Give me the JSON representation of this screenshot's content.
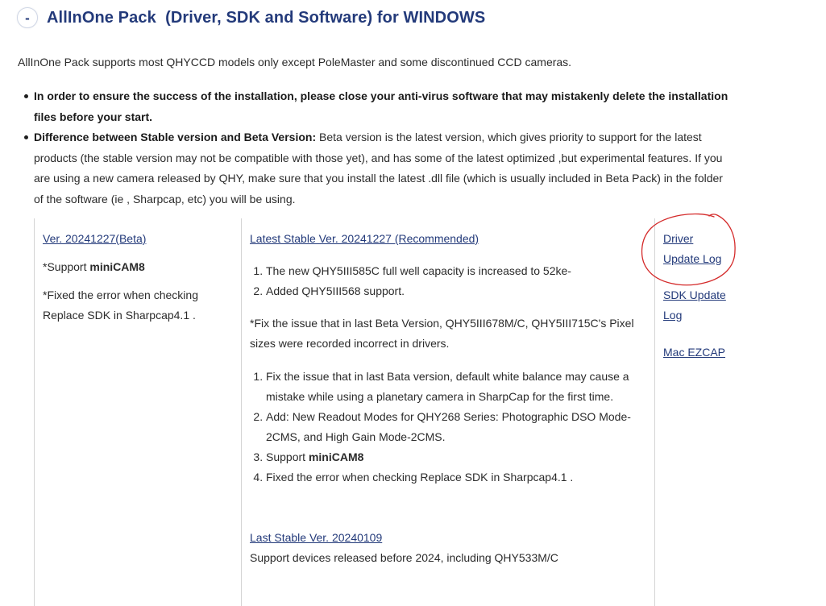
{
  "section": {
    "toggle_symbol": "-",
    "title": "AllInOne Pack  (Driver, SDK and Software) for WINDOWS",
    "intro": "AllInOne Pack supports most QHYCCD models only except PoleMaster and some discontinued CCD cameras."
  },
  "bullets": [
    {
      "bold": "In order to ensure the success of the installation, please close your anti-virus software that may mistakenly delete the installation files before your start.",
      "text": ""
    },
    {
      "bold": "Difference between Stable version and Beta Version:",
      "text": " Beta version is the latest version, which gives priority to support for the latest products (the stable version may not be compatible with those yet), and has some of the latest optimized ,but experimental features. If you are using a new camera released by QHY, make sure that you install the latest .dll file (which is usually included in Beta Pack) in the folder of the software (ie , Sharpcap, etc) you will be using."
    }
  ],
  "beta": {
    "link": "Ver. 20241227(Beta)",
    "support_prefix": "*Support ",
    "support_model": "miniCAM8",
    "fix_note": "*Fixed the error when checking Replace SDK in Sharpcap4.1 ."
  },
  "stable": {
    "link": "Latest Stable Ver. 20241227 (Recommended)",
    "list1": [
      "The new QHY5III585C full well capacity is increased to 52ke-",
      "Added QHY5III568 support."
    ],
    "fix_note": "*Fix the issue that in last Beta Version, QHY5III678M/C, QHY5III715C's Pixel sizes were recorded incorrect in drivers.",
    "list2_item1": "Fix the issue that in last Bata version, default white balance may cause a mistake while using a planetary camera in SharpCap for the first time.",
    "list2_item2": "Add: New Readout Modes for QHY268 Series: Photographic DSO Mode-2CMS, and High Gain Mode-2CMS.",
    "list2_item3_prefix": "Support ",
    "list2_item3_model": "miniCAM8",
    "list2_item4": "Fixed the error when checking Replace SDK in Sharpcap4.1 .",
    "last_link": "Last Stable Ver. 20240109",
    "last_text": "Support devices released before 2024, including QHY533M/C"
  },
  "side_links": {
    "driver_line1": "Driver",
    "driver_line2": "Update Log",
    "sdk_line1": "SDK Update",
    "sdk_line2": "Log",
    "mac": "Mac EZCAP"
  },
  "colors": {
    "accent": "#233a7a",
    "annotation": "#d42a2a"
  }
}
